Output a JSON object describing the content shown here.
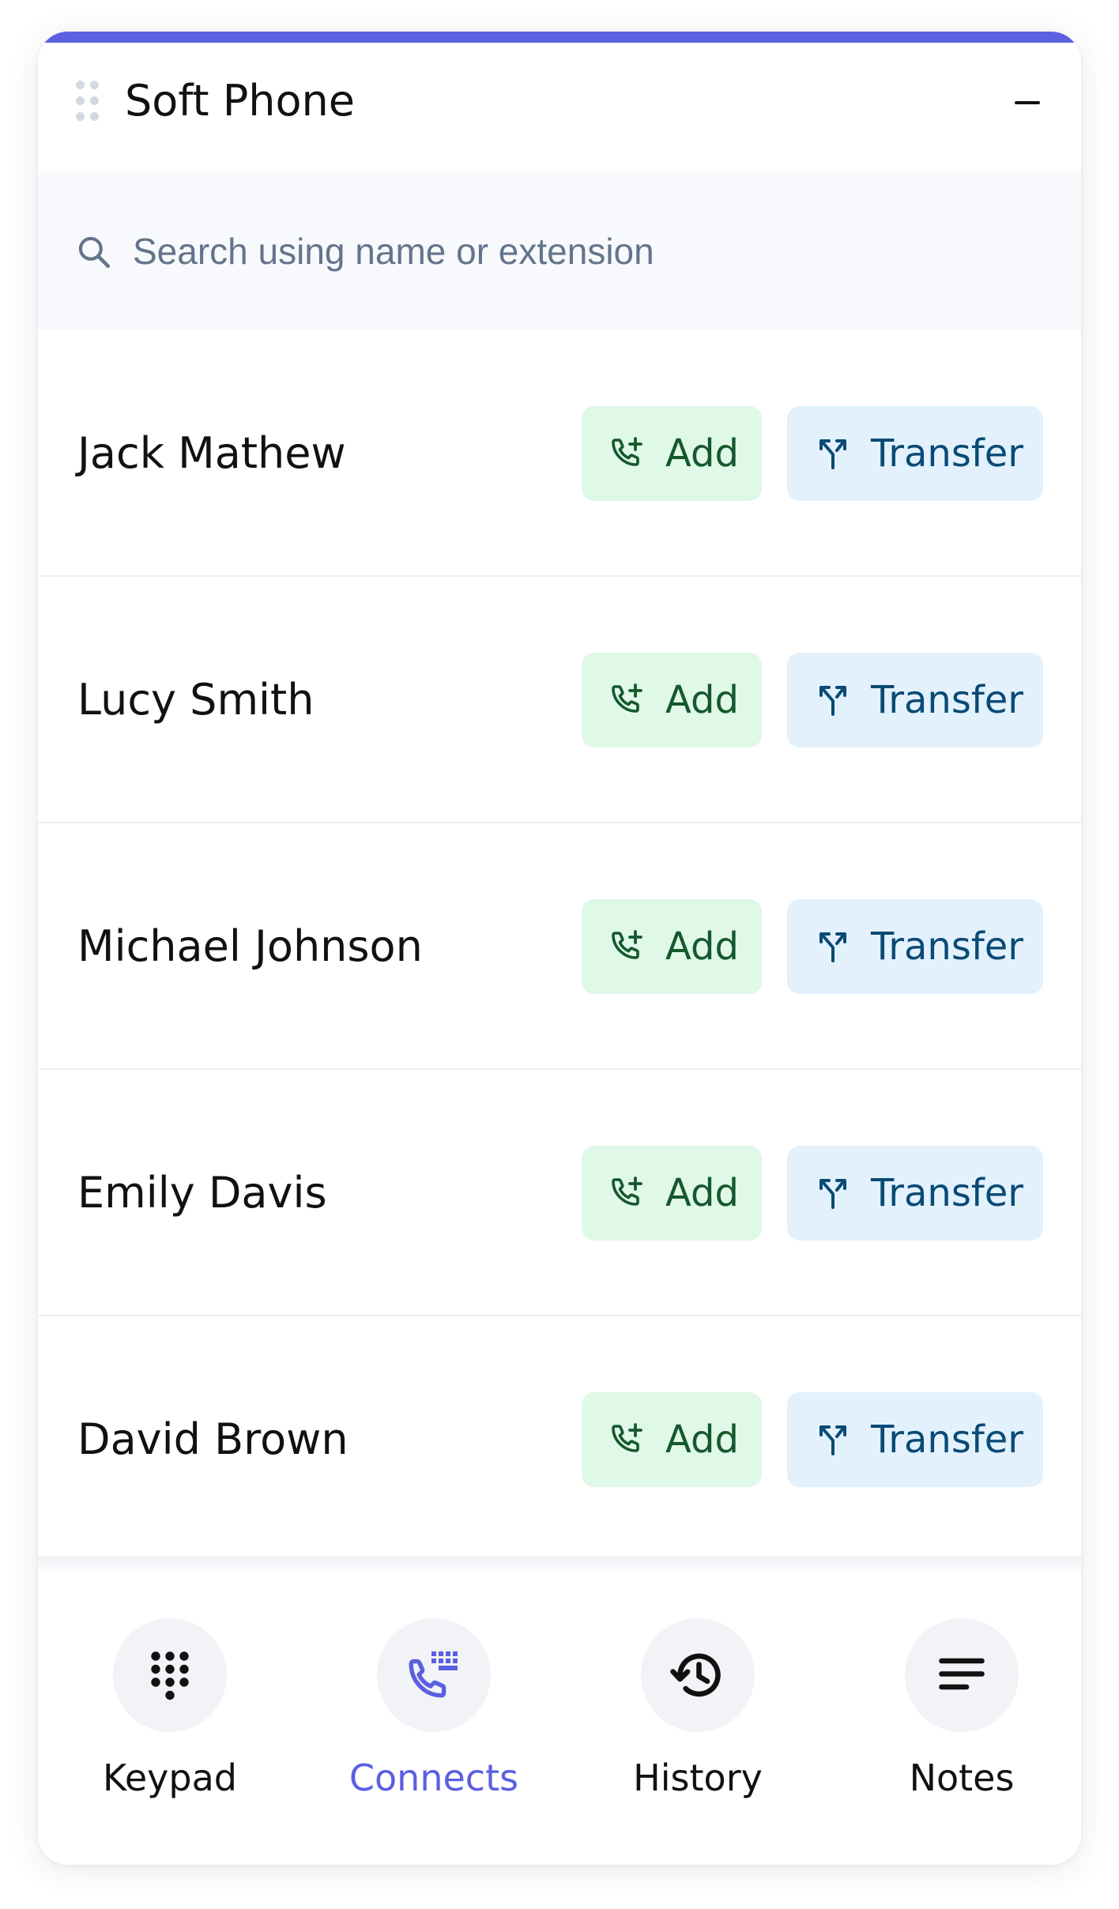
{
  "app": {
    "title": "Soft Phone",
    "accent_color": "#5b5fe0"
  },
  "search": {
    "placeholder": "Search using name or extension",
    "value": ""
  },
  "contacts": [
    {
      "name": "Jack Mathew",
      "add_label": "Add",
      "transfer_label": "Transfer"
    },
    {
      "name": "Lucy Smith",
      "add_label": "Add",
      "transfer_label": "Transfer"
    },
    {
      "name": "Michael Johnson",
      "add_label": "Add",
      "transfer_label": "Transfer"
    },
    {
      "name": "Emily Davis",
      "add_label": "Add",
      "transfer_label": "Transfer"
    },
    {
      "name": "David Brown",
      "add_label": "Add",
      "transfer_label": "Transfer"
    }
  ],
  "buttons": {
    "add_icon": "phone-add-icon",
    "transfer_icon": "call-split-icon",
    "add_bg": "#dff8e7",
    "add_color": "#15582d",
    "transfer_bg": "#e2f1fc",
    "transfer_color": "#0a4a75"
  },
  "nav": {
    "active": "connects",
    "items": [
      {
        "id": "keypad",
        "label": "Keypad",
        "icon": "dialpad-icon"
      },
      {
        "id": "connects",
        "label": "Connects",
        "icon": "phone-keypad-icon"
      },
      {
        "id": "history",
        "label": "History",
        "icon": "history-icon"
      },
      {
        "id": "notes",
        "label": "Notes",
        "icon": "notes-icon"
      }
    ]
  }
}
